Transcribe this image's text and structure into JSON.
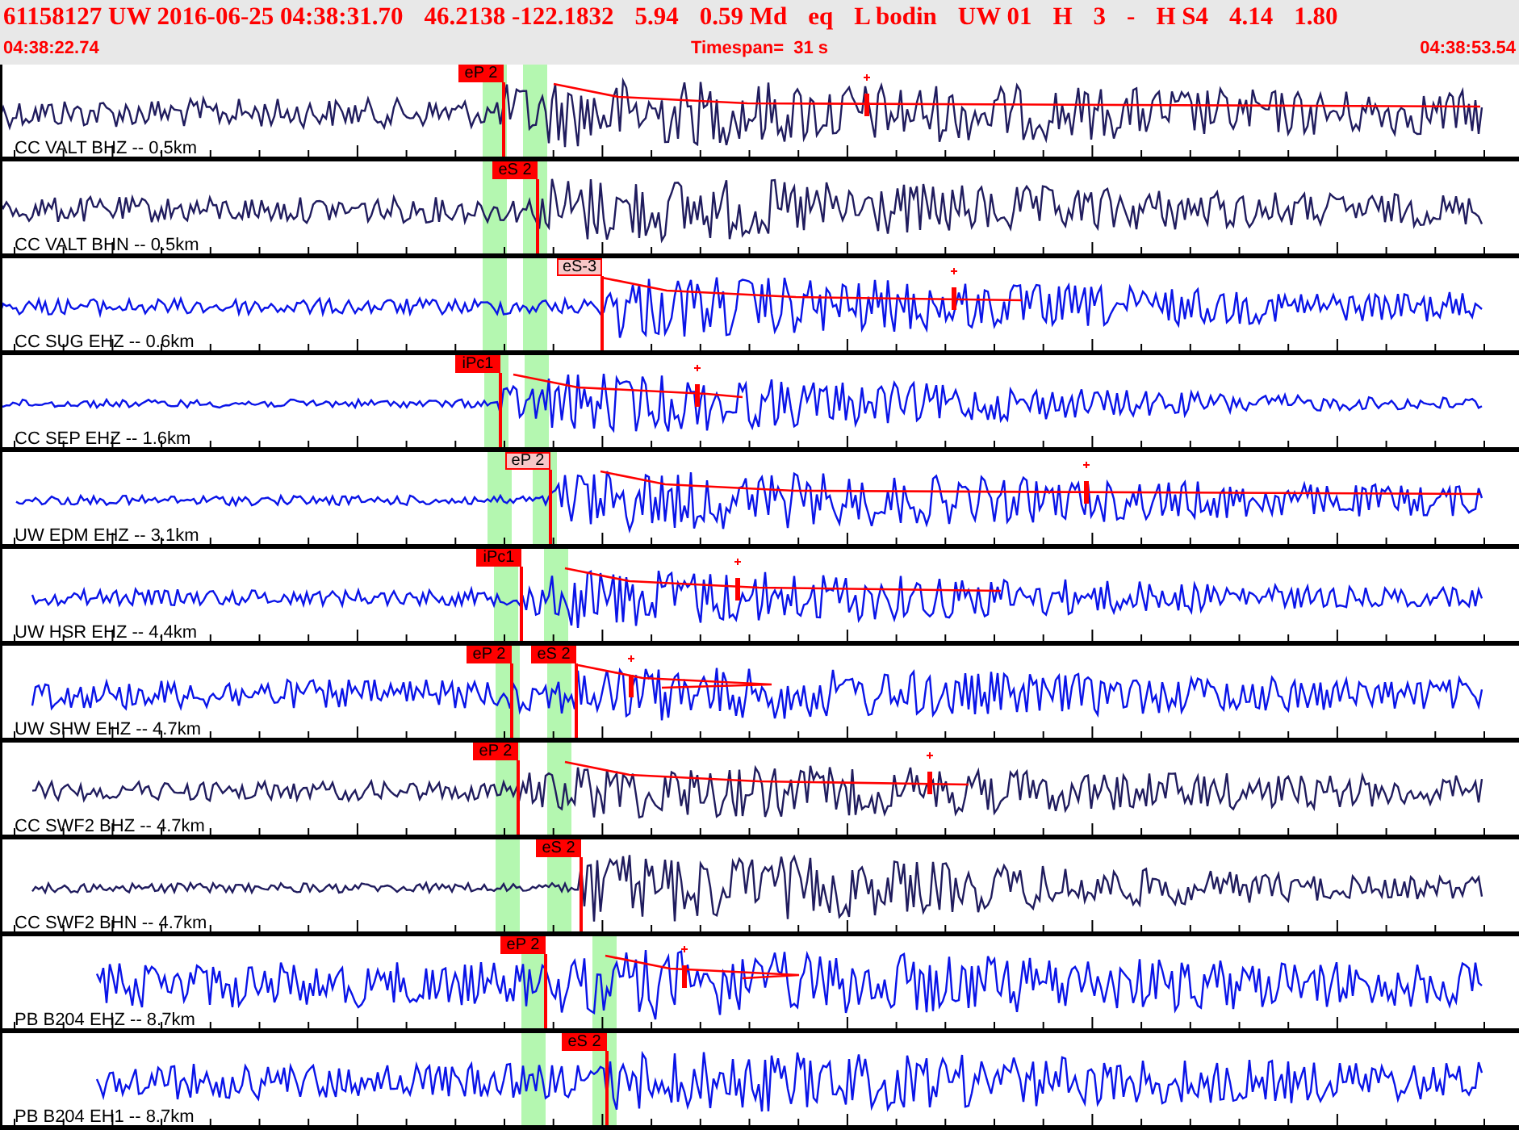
{
  "header": {
    "event_fields": [
      "61158127 UW 2016-06-25 04:38:31.70",
      "46.2138 -122.1832",
      "5.94",
      "0.59 Md",
      "eq",
      "L bodin",
      "UW 01",
      "H",
      "3",
      "-",
      "H S4",
      "4.14",
      "1.80"
    ],
    "start_time": "04:38:22.74",
    "timespan": "Timespan=  31 s",
    "end_time": "04:38:53.54"
  },
  "traces": [
    {
      "label": "CC VALT BHZ -- 0.5km",
      "color": "#201c5e",
      "picks": [
        {
          "label": "eP 2",
          "selected": false
        }
      ]
    },
    {
      "label": "CC VALT BHN -- 0.5km",
      "color": "#201c5e",
      "picks": [
        {
          "label": "eS 2",
          "selected": false
        }
      ]
    },
    {
      "label": "CC SUG EHZ -- 0.6km",
      "color": "#0a14e8",
      "picks": [
        {
          "label": "eS-3",
          "selected": true
        }
      ]
    },
    {
      "label": "CC SEP EHZ -- 1.6km",
      "color": "#0a14e8",
      "picks": [
        {
          "label": "iPc1",
          "selected": false
        }
      ]
    },
    {
      "label": "UW EDM EHZ -- 3.1km",
      "color": "#0a14e8",
      "picks": [
        {
          "label": "eP 2",
          "selected": true
        }
      ]
    },
    {
      "label": "UW HSR EHZ -- 4.4km",
      "color": "#0a14e8",
      "picks": [
        {
          "label": "iPc1",
          "selected": false
        }
      ]
    },
    {
      "label": "UW SHW EHZ -- 4.7km",
      "color": "#0a14e8",
      "picks": [
        {
          "label": "eP 2",
          "selected": false
        },
        {
          "label": "eS 2",
          "selected": false
        }
      ]
    },
    {
      "label": "CC SWF2 BHZ -- 4.7km",
      "color": "#201c5e",
      "picks": [
        {
          "label": "eP 2",
          "selected": false
        }
      ]
    },
    {
      "label": "CC SWF2 BHN -- 4.7km",
      "color": "#201c5e",
      "picks": [
        {
          "label": "eS 2",
          "selected": false
        }
      ]
    },
    {
      "label": "PB B204 EHZ -- 8.7km",
      "color": "#0a14e8",
      "picks": [
        {
          "label": "eP 2",
          "selected": false
        }
      ]
    },
    {
      "label": "PB B204 EH1 -- 8.7km",
      "color": "#0a14e8",
      "picks": [
        {
          "label": "eS 2",
          "selected": false
        }
      ]
    }
  ]
}
